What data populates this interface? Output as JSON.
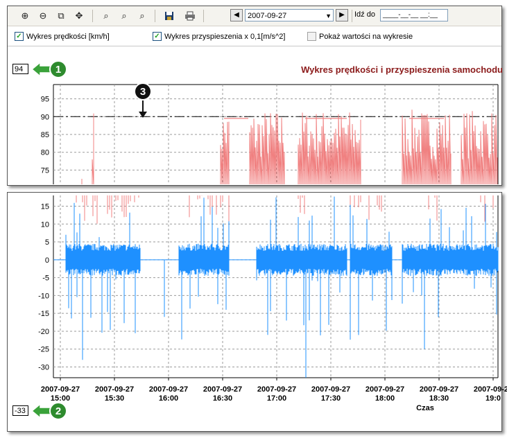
{
  "toolbar": {
    "icons": [
      "zoom-in-icon",
      "zoom-out-icon",
      "zoom-page-icon",
      "pan-icon",
      "zoom-x-icon",
      "zoom-y-out-icon",
      "zoom-reset-icon",
      "save-icon",
      "print-icon"
    ],
    "date": "2007-09-27",
    "goto_label": "Idź do",
    "time_placeholder": "____-__-__ __:__"
  },
  "options": {
    "speed_label": "Wykres prędkości [km/h]",
    "speed_checked": true,
    "accel_label": "Wykres przyspieszenia x 0,1[m/s^2]",
    "accel_checked": true,
    "values_label": "Pokaż wartości na wykresie",
    "values_checked": false
  },
  "callouts": {
    "max_value": "94",
    "min_value": "-33",
    "badge1": "1",
    "badge2": "2",
    "badge3": "3"
  },
  "colors": {
    "speed": "#f08080",
    "accel": "#1e90ff",
    "limit": "#000000",
    "title": "#8b1a1a",
    "badge_green": "#2e8b2e"
  },
  "chart_data": [
    {
      "type": "line",
      "title": "Wykres prędkości i przyspieszenia samochodu",
      "series": [
        {
          "values": []
        }
      ],
      "y_ticks": [
        95,
        90,
        85,
        80,
        75
      ],
      "ylim": [
        71,
        99
      ],
      "limit_line": 90,
      "grid": true
    },
    {
      "type": "bar",
      "xlabel": "Czas",
      "x_ticks": [
        {
          "date": "2007-09-27",
          "time": "15:00"
        },
        {
          "date": "2007-09-27",
          "time": "15:30"
        },
        {
          "date": "2007-09-27",
          "time": "16:00"
        },
        {
          "date": "2007-09-27",
          "time": "16:30"
        },
        {
          "date": "2007-09-27",
          "time": "17:00"
        },
        {
          "date": "2007-09-27",
          "time": "17:30"
        },
        {
          "date": "2007-09-27",
          "time": "18:00"
        },
        {
          "date": "2007-09-27",
          "time": "18:30"
        },
        {
          "date": "2007-09-27",
          "time": "19:0"
        }
      ],
      "y_ticks": [
        15,
        10,
        5,
        0,
        -5,
        -10,
        -15,
        -20,
        -25,
        -30
      ],
      "ylim": [
        -33,
        18
      ],
      "grid": true
    }
  ]
}
